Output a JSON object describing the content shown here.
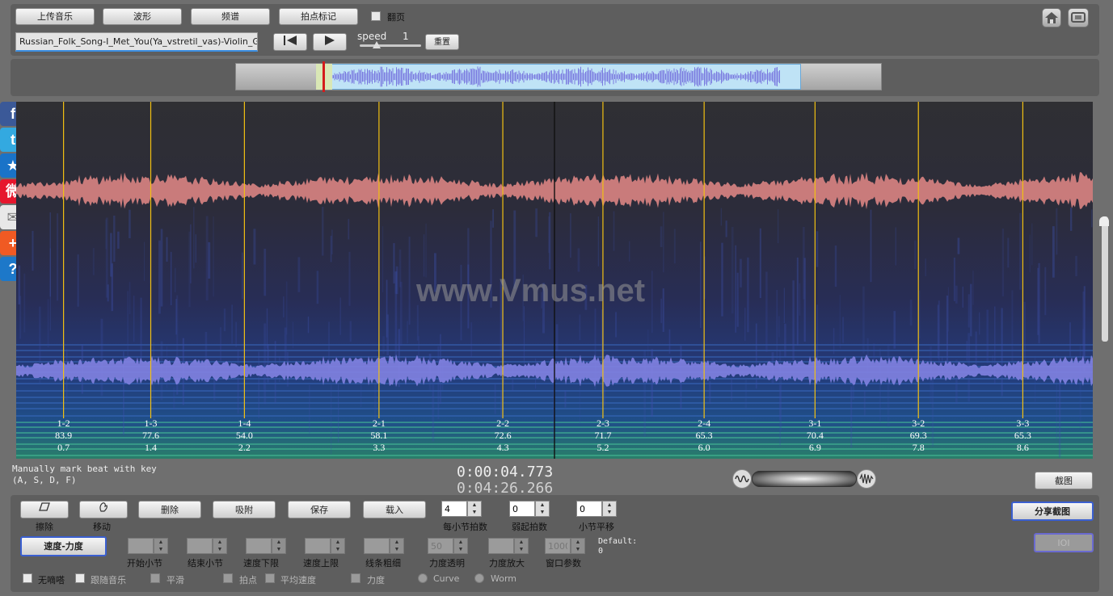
{
  "toolbar": {
    "upload_label": "上传音乐",
    "waveform_label": "波形",
    "spectrum_label": "频谱",
    "beat_mark_label": "拍点标记",
    "page_turn_label": "翻页",
    "filename": "Russian_Folk_Song-I_Met_You(Ya_vstretil_vas)-Violin_Guit",
    "speed_label": "speed",
    "speed_value": "1",
    "mute_label": "重置"
  },
  "spectrogram": {
    "watermark": "www.Vmus.net",
    "beats": [
      {
        "label": "1-2",
        "tempo": "83.9",
        "time": "0.7",
        "pos": 0.044
      },
      {
        "label": "1-3",
        "tempo": "77.6",
        "time": "1.4",
        "pos": 0.125
      },
      {
        "label": "1-4",
        "tempo": "54.0",
        "time": "2.2",
        "pos": 0.212
      },
      {
        "label": "2-1",
        "tempo": "58.1",
        "time": "3.3",
        "pos": 0.337
      },
      {
        "label": "2-2",
        "tempo": "72.6",
        "time": "4.3",
        "pos": 0.452
      },
      {
        "label": "2-3",
        "tempo": "71.7",
        "time": "5.2",
        "pos": 0.545
      },
      {
        "label": "2-4",
        "tempo": "65.3",
        "time": "6.0",
        "pos": 0.639
      },
      {
        "label": "3-1",
        "tempo": "70.4",
        "time": "6.9",
        "pos": 0.742
      },
      {
        "label": "3-2",
        "tempo": "69.3",
        "time": "7.8",
        "pos": 0.838
      },
      {
        "label": "3-3",
        "tempo": "65.3",
        "time": "8.6",
        "pos": 0.935
      }
    ],
    "cursor_pos": 0.5
  },
  "status": {
    "hint_line1": "Manually mark beat with key",
    "hint_line2": "(A, S, D, F)",
    "current_time": "0:00:04.773",
    "total_time": "0:04:26.266",
    "screenshot_label": "截图"
  },
  "controls": {
    "erase_label": "擦除",
    "move_label": "移动",
    "delete_label": "删除",
    "snap_label": "吸附",
    "save_label": "保存",
    "load_label": "载入",
    "beats_per_bar_label": "每小节拍数",
    "beats_per_bar_value": "4",
    "pickup_label": "弱起拍数",
    "pickup_value": "0",
    "bar_shift_label": "小节平移",
    "bar_shift_value": "0",
    "share_label": "分享截图",
    "ioi_label": "IOI",
    "speed_force_label": "速度-力度",
    "start_bar_label": "开始小节",
    "end_bar_label": "结束小节",
    "tempo_low_label": "速度下限",
    "tempo_high_label": "速度上限",
    "line_width_label": "线条粗细",
    "force_alpha_label": "力度透明",
    "force_zoom_label": "力度放大",
    "window_param_label": "窗口参数",
    "force_alpha_value": "50",
    "window_param_value": "1000",
    "default_label": "Default:",
    "default_value": "0",
    "no_beep_label": "无嘀嗒",
    "follow_music_label": "跟随音乐",
    "smooth_label": "平滑",
    "beat_point_label": "拍点",
    "avg_tempo_label": "平均速度",
    "force_label": "力度",
    "curve_label": "Curve",
    "worm_label": "Worm"
  },
  "social": [
    {
      "name": "facebook",
      "glyph": "f",
      "color": "#3b5998"
    },
    {
      "name": "twitter",
      "glyph": "t",
      "color": "#33a9e0"
    },
    {
      "name": "favorite",
      "glyph": "★",
      "color": "#1a73c8"
    },
    {
      "name": "weibo",
      "glyph": "微",
      "color": "#e6162d"
    },
    {
      "name": "email",
      "glyph": "✉",
      "color": "#e8e8e8"
    },
    {
      "name": "add",
      "glyph": "+",
      "color": "#f05a23"
    },
    {
      "name": "help",
      "glyph": "?",
      "color": "#1d78c9"
    }
  ]
}
